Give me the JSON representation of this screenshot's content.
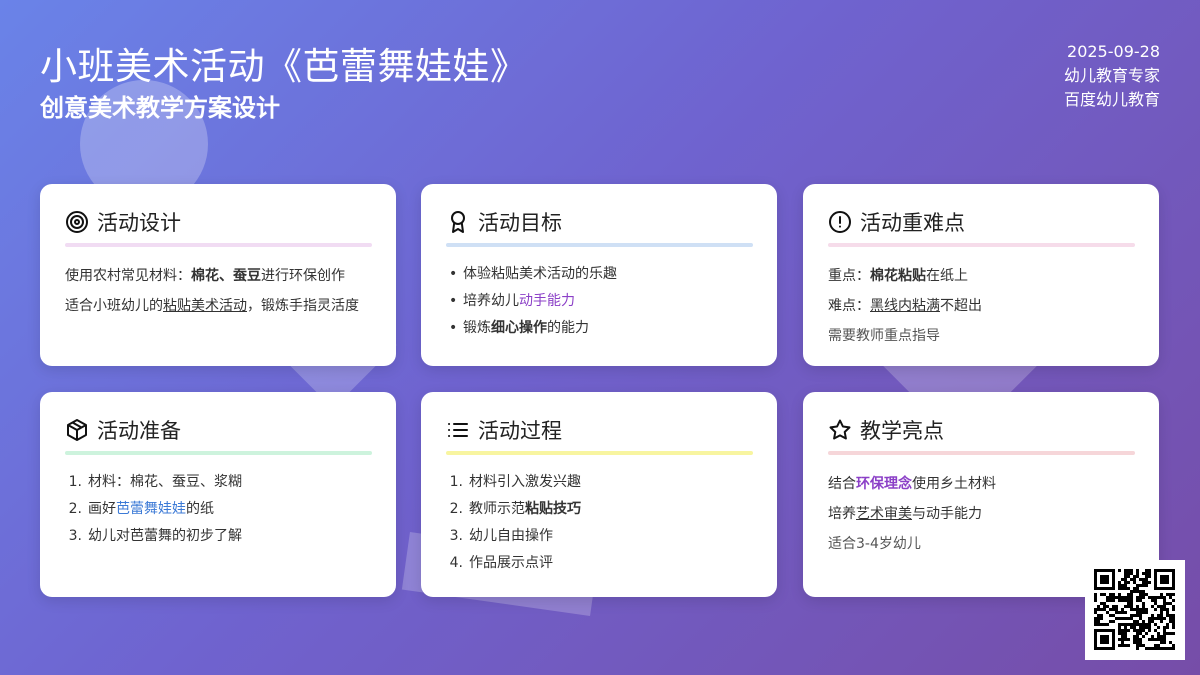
{
  "header": {
    "title": "小班美术活动《芭蕾舞娃娃》",
    "subtitle": "创意美术教学方案设计"
  },
  "meta": {
    "date": "2025-09-28",
    "author": "幼儿教育专家",
    "source": "百度幼儿教育"
  },
  "colors": {
    "bar_design": "#f1dcf3",
    "bar_goal": "#cfe0f5",
    "bar_difficulty": "#f6dcea",
    "bar_prep": "#cdf3dd",
    "bar_process": "#f8f5a0",
    "bar_highlight": "#f6d6d9",
    "emphasis_purple": "#8b3fc7",
    "emphasis_blue": "#3c7ad6"
  },
  "cards": {
    "design": {
      "icon": "target-icon",
      "title": "活动设计",
      "l1_a": "使用农村常见材料：",
      "l1_b": "棉花、蚕豆",
      "l1_c": "进行环保创作",
      "l2_a": "适合小班幼儿的",
      "l2_b": "粘贴美术活动",
      "l2_c": "，锻炼手指灵活度"
    },
    "goal": {
      "icon": "award-icon",
      "title": "活动目标",
      "i1": "体验粘贴美术活动的乐趣",
      "i2_a": "培养幼儿",
      "i2_b": "动手能力",
      "i3_a": "锻炼",
      "i3_b": "细心操作",
      "i3_c": "的能力"
    },
    "difficulty": {
      "icon": "alert-circle-icon",
      "title": "活动重难点",
      "l1_a": "重点：",
      "l1_b": "棉花粘贴",
      "l1_c": "在纸上",
      "l2_a": "难点：",
      "l2_b": "黑线内粘满",
      "l2_c": "不超出",
      "l3": "需要教师重点指导"
    },
    "prep": {
      "icon": "box-icon",
      "title": "活动准备",
      "i1": "材料：棉花、蚕豆、浆糊",
      "i2_a": "画好",
      "i2_b": "芭蕾舞娃娃",
      "i2_c": "的纸",
      "i3": "幼儿对芭蕾舞的初步了解"
    },
    "process": {
      "icon": "list-icon",
      "title": "活动过程",
      "i1": "材料引入激发兴趣",
      "i2_a": "教师示范",
      "i2_b": "粘贴技巧",
      "i3": "幼儿自由操作",
      "i4": "作品展示点评"
    },
    "highlight": {
      "icon": "star-icon",
      "title": "教学亮点",
      "l1_a": "结合",
      "l1_b": "环保理念",
      "l1_c": "使用乡土材料",
      "l2_a": "培养",
      "l2_b": "艺术审美",
      "l2_c": "与动手能力",
      "l3": "适合3-4岁幼儿"
    }
  },
  "nums": [
    "1.",
    "2.",
    "3.",
    "4."
  ],
  "qr": {
    "icon": "qr-code-icon"
  }
}
